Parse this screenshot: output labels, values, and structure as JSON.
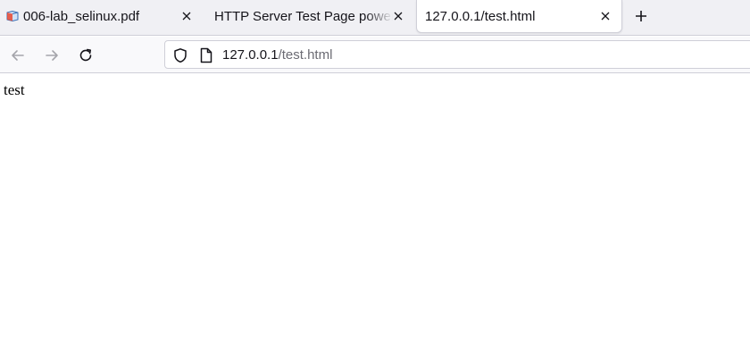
{
  "tabs": [
    {
      "title": "006-lab_selinux.pdf",
      "icon": "pdf-icon",
      "active": false
    },
    {
      "title": "HTTP Server Test Page powered by",
      "active": false
    },
    {
      "title": "127.0.0.1/test.html",
      "active": true
    }
  ],
  "urlbar": {
    "host": "127.0.0.1",
    "path": "/test.html"
  },
  "page": {
    "body_text": "test"
  },
  "colors": {
    "tabstrip_bg": "#f0f0f4",
    "active_tab_bg": "#ffffff",
    "navbar_bg": "#f9f9fb",
    "url_path": "#6b6b73"
  }
}
